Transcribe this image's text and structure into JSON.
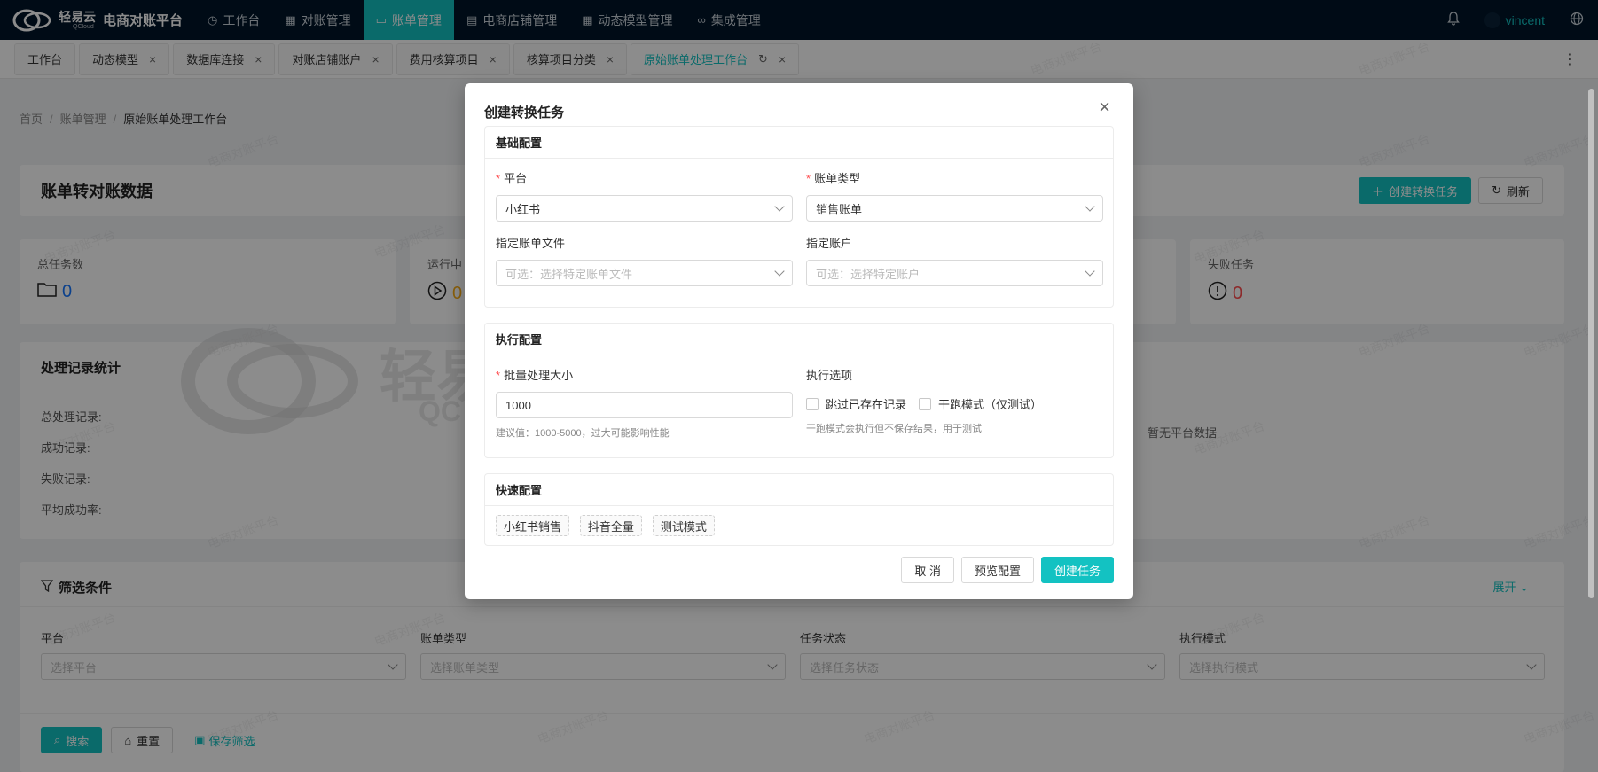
{
  "nav": {
    "logo_brand": "轻易云",
    "logo_sub": "QCloud",
    "app_name": "电商对账平台",
    "items": [
      {
        "label": "工作台",
        "icon": "clock-icon"
      },
      {
        "label": "对账管理",
        "icon": "grid-icon"
      },
      {
        "label": "账单管理",
        "icon": "book-icon"
      },
      {
        "label": "电商店铺管理",
        "icon": "store-icon"
      },
      {
        "label": "动态模型管理",
        "icon": "table-icon"
      },
      {
        "label": "集成管理",
        "icon": "link-icon"
      }
    ],
    "user": "vincent"
  },
  "tabs": [
    {
      "label": "工作台"
    },
    {
      "label": "动态模型"
    },
    {
      "label": "数据库连接"
    },
    {
      "label": "对账店铺账户"
    },
    {
      "label": "费用核算项目"
    },
    {
      "label": "核算项目分类"
    },
    {
      "label": "原始账单处理工作台"
    }
  ],
  "breadcrumb": {
    "home": "首页",
    "parent": "账单管理",
    "current": "原始账单处理工作台"
  },
  "page": {
    "title": "账单转对账数据",
    "create_btn": "创建转换任务",
    "refresh_btn": "刷新",
    "stats": [
      {
        "label": "总任务数",
        "value": "0",
        "color": "#1677ff"
      },
      {
        "label": "运行中",
        "value": "0",
        "color": "#faad14"
      },
      {
        "label": "失败任务",
        "value": "0",
        "color": "#ff4d4f"
      }
    ],
    "proc_title": "处理记录统计",
    "proc_rows": [
      "总处理记录:",
      "成功记录:",
      "失败记录:",
      "平均成功率:"
    ],
    "no_platform": "暂无平台数据",
    "watermark": "电商对账平台",
    "big_watermark": "轻易",
    "big_watermark_sub": "QC"
  },
  "filter": {
    "title": "筛选条件",
    "expand": "展开",
    "fields": [
      {
        "label": "平台",
        "placeholder": "选择平台"
      },
      {
        "label": "账单类型",
        "placeholder": "选择账单类型"
      },
      {
        "label": "任务状态",
        "placeholder": "选择任务状态"
      },
      {
        "label": "执行模式",
        "placeholder": "选择执行模式"
      }
    ],
    "search_btn": "搜索",
    "reset_btn": "重置",
    "save_link": "保存筛选"
  },
  "modal": {
    "title": "创建转换任务",
    "basic": {
      "title": "基础配置",
      "platform_label": "平台",
      "platform_value": "小红书",
      "bill_type_label": "账单类型",
      "bill_type_value": "销售账单",
      "file_label": "指定账单文件",
      "file_placeholder": "可选：选择特定账单文件",
      "account_label": "指定账户",
      "account_placeholder": "可选：选择特定账户"
    },
    "exec": {
      "title": "执行配置",
      "batch_label": "批量处理大小",
      "batch_value": "1000",
      "batch_hint": "建议值：1000-5000，过大可能影响性能",
      "options_label": "执行选项",
      "opt_skip": "跳过已存在记录",
      "opt_dry": "干跑模式（仅测试）",
      "options_hint": "干跑模式会执行但不保存结果，用于测试"
    },
    "quick": {
      "title": "快速配置",
      "tags": [
        "小红书销售",
        "抖音全量",
        "测试模式"
      ]
    },
    "cancel_btn": "取 消",
    "preview_btn": "预览配置",
    "create_btn": "创建任务"
  }
}
